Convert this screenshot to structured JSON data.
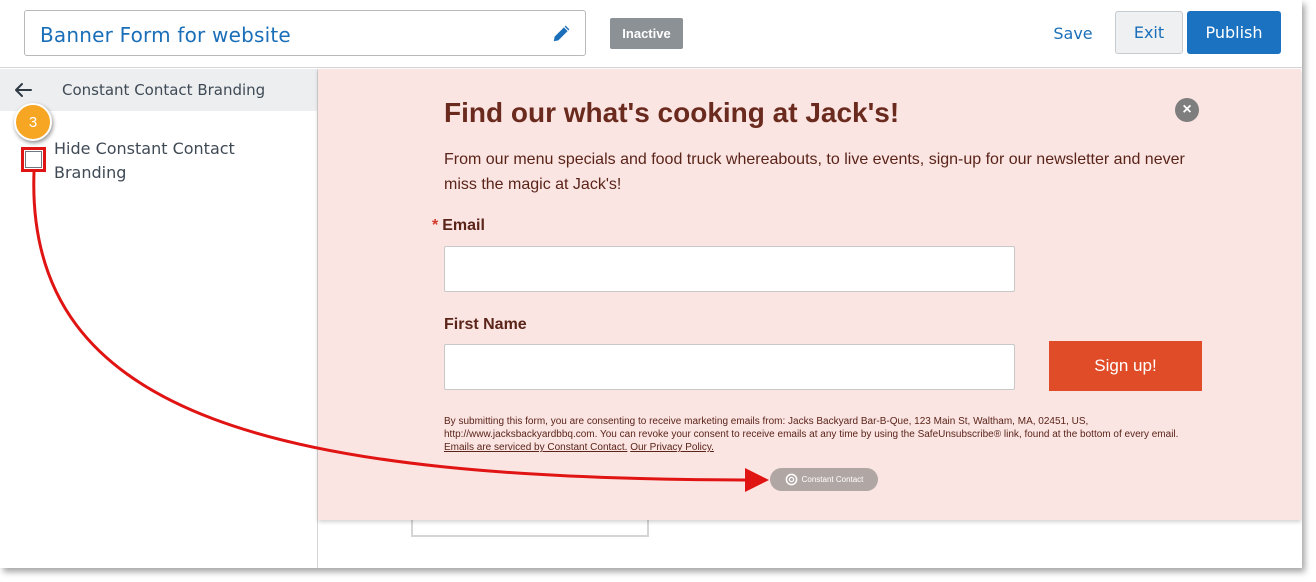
{
  "header": {
    "form_title": "Banner Form for website",
    "status": "Inactive",
    "save_label": "Save",
    "exit_label": "Exit",
    "publish_label": "Publish"
  },
  "sidebar": {
    "title": "Constant Contact Branding",
    "option_label": "Hide Constant Contact Branding",
    "option_checked": false,
    "step_number": "3"
  },
  "form": {
    "headline": "Find our what's cooking at Jack's!",
    "intro": "From our menu specials and food truck whereabouts, to live events, sign-up for our newsletter and never miss the magic at Jack's!",
    "required_marker": "*",
    "email_label": "Email",
    "first_name_label": "First Name",
    "signup_label": "Sign up!",
    "consent_text": "By submitting this form, you are consenting to receive marketing emails from: Jacks Backyard Bar-B-Que, 123 Main St, Waltham, MA, 02451, US, http://www.jacksbackyardbbq.com. You can revoke your consent to receive emails at any time by using the SafeUnsubscribe® link, found at the bottom of every email.",
    "service_link": "Emails are serviced by Constant Contact.",
    "privacy_link": "Our Privacy Policy.",
    "branding_badge": "Constant Contact",
    "close_symbol": "×"
  },
  "colors": {
    "accent_blue": "#1a72c0",
    "banner_bg": "#fbe5e3",
    "signup_red": "#e04b28",
    "annotation_red": "#e11414",
    "step_orange": "#f6a623"
  },
  "icons": {
    "edit": "pencil-icon",
    "back": "arrow-left-icon",
    "close": "close-icon",
    "brand": "constant-contact-logo-icon"
  }
}
